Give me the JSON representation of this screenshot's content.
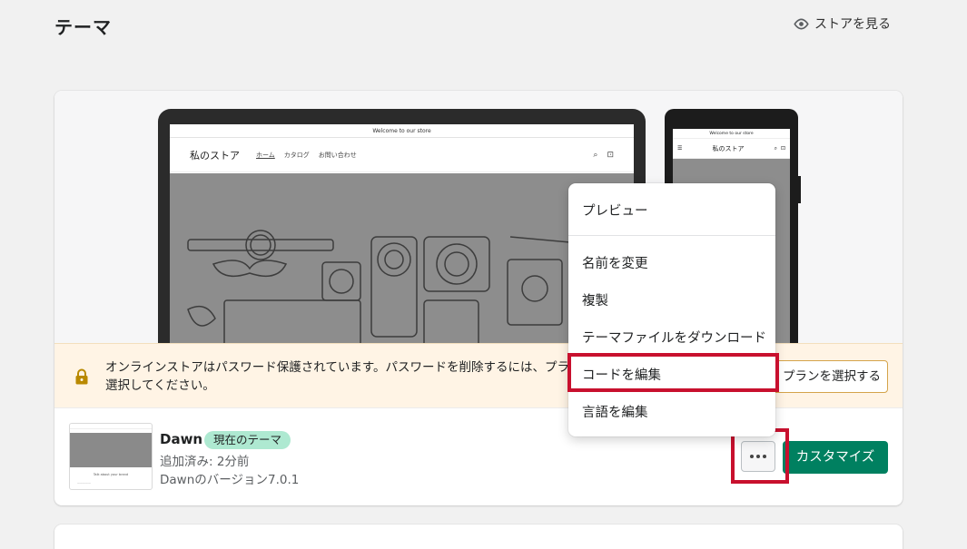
{
  "page": {
    "title": "テーマ"
  },
  "header": {
    "view_store": "ストアを見る"
  },
  "preview": {
    "announcement": "Welcome to our store",
    "store_name": "私のストア",
    "nav": [
      "ホーム",
      "カタログ",
      "お問い合わせ"
    ]
  },
  "banner": {
    "message": "オンラインストアはパスワード保護されています。パスワードを削除するには、プランを選択してください。",
    "button": "プランを選択する"
  },
  "theme": {
    "name": "Dawn",
    "badge": "現在のテーマ",
    "added": "追加済み: 2分前",
    "version": "Dawnのバージョン7.0.1",
    "customize": "カスタマイズ",
    "thumb_text": "Talk about your brand"
  },
  "menu": {
    "items": [
      "プレビュー",
      "名前を変更",
      "複製",
      "テーマファイルをダウンロード",
      "コードを編集",
      "言語を編集"
    ]
  },
  "colors": {
    "primary": "#008060",
    "highlight": "#c8102e",
    "banner_bg": "#fff4e5",
    "badge_bg": "#aee9d1"
  }
}
